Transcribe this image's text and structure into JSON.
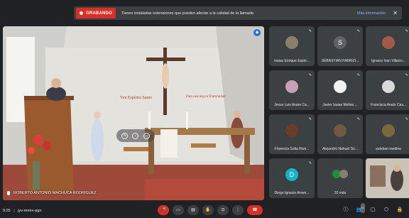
{
  "banner": {
    "recording_label": "GRABANDO",
    "message": "Tienes instaladas extensiones que pueden afectar a la calidad de la llamada",
    "link": "Más información",
    "close_icon": "close-icon"
  },
  "main_video": {
    "speaker_name": "ROBERTO ANTONIO MACHUCA RODRIGUEZ",
    "pin_icon": "pin-icon",
    "wall_text_left": "Ven Espíritu Santo",
    "wall_text_right": "Para una mayor Fraternidad"
  },
  "participants": [
    {
      "name": "Isaias Enrique Espin...",
      "avatar": "photo",
      "color": "#8a7f6e"
    },
    {
      "name": "SEBASTIAN FABRIZI...",
      "avatar": "S",
      "color": "#5f6368"
    },
    {
      "name": "Ignacio Ivan Villarro...",
      "avatar": "photo",
      "color": "#a05a4a"
    },
    {
      "name": "Jesus Luis Araos Ca...",
      "avatar": "photo",
      "color": "#c8a0b8"
    },
    {
      "name": "Javier Isaias Molina ...",
      "avatar": "photo",
      "color": "#f2f2f2"
    },
    {
      "name": "Francisca Anaís Cas...",
      "avatar": "photo",
      "color": "#d9d9d9"
    },
    {
      "name": "Florencia Sofia Rive...",
      "avatar": "photo",
      "color": "#6b3b2a"
    },
    {
      "name": "Alejandro Nahuel So...",
      "avatar": "photo",
      "color": "#6d5a3f"
    },
    {
      "name": "esteban medina",
      "avatar": "photo",
      "color": "#7a6a3a"
    },
    {
      "name": "Diego Ignacio Arsen...",
      "avatar": "D",
      "color": "#12b5cb"
    },
    {
      "name": "20 más",
      "avatar": "group",
      "color": "#1e8e3e"
    }
  ],
  "bottom": {
    "time": "9:25",
    "meeting_code": "jyv-mmrv-pgn",
    "badge_count": "31"
  }
}
